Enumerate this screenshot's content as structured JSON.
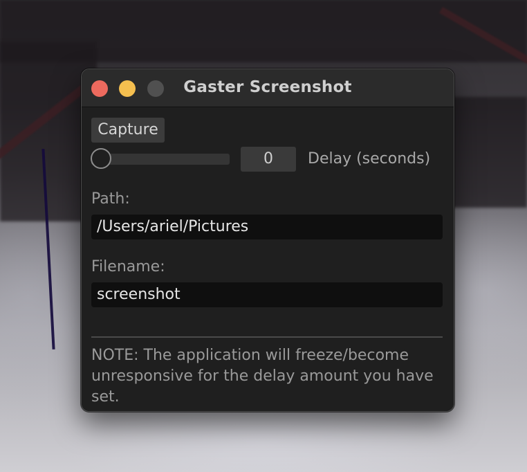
{
  "window": {
    "title": "Gaster Screenshot",
    "controls": {
      "close_color": "#ed6a5e",
      "minimize_color": "#f5bf4f",
      "zoom_color": "#505050"
    }
  },
  "capture": {
    "button_label": "Capture",
    "delay_slider_value": 0,
    "delay_slider_max": 10,
    "delay_value_text": "0",
    "delay_label": "Delay (seconds)"
  },
  "path": {
    "label": "Path:",
    "value": "/Users/ariel/Pictures"
  },
  "filename": {
    "label": "Filename:",
    "value": "screenshot"
  },
  "note": {
    "text": "NOTE: The application will freeze/become unresponsive for the delay amount you have set."
  }
}
